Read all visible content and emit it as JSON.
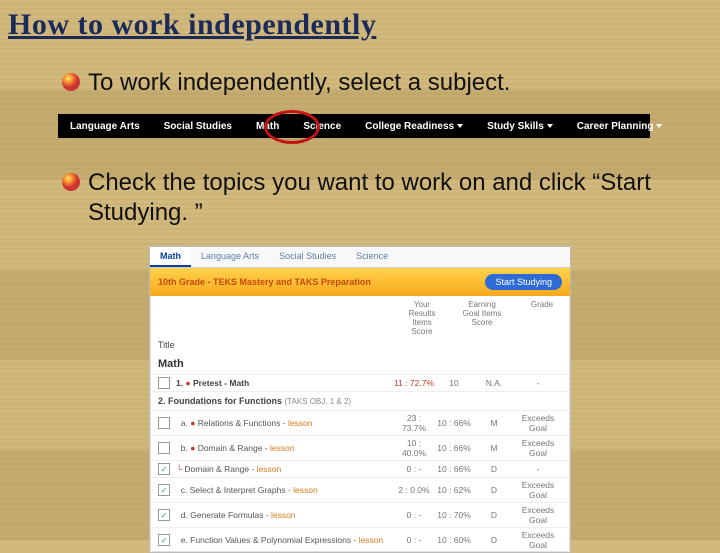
{
  "title": "How to work independently",
  "point1": "To work independently, select a subject.",
  "point2": "Check the topics you want to work on and click “Start Studying. ”",
  "navbar": {
    "items": [
      "Language Arts",
      "Social Studies",
      "Math",
      "Science",
      "College Readiness",
      "Study Skills",
      "Career Planning"
    ]
  },
  "panel": {
    "tabs": [
      "Math",
      "Language Arts",
      "Social Studies",
      "Science"
    ],
    "band_title": "10th Grade - TEKS Mastery and TAKS Preparation",
    "band_button": "Start Studying",
    "thead": {
      "c1": "Your Results Items Score",
      "c2": "Earning Goal Items Score",
      "c3": "Grade"
    },
    "title_label": "Title",
    "subject": "Math",
    "row0": {
      "name": "1.",
      "bullet": "●",
      "label": "Pretest - Math",
      "c1": "11 : 72.7%",
      "c2": "10",
      "c3": "N.A.",
      "c4": "-"
    },
    "section2": {
      "title": "2. Foundations for Functions",
      "meta": "(TAKS OBJ. 1 & 2)"
    },
    "rows": [
      {
        "cb": false,
        "name": "a.",
        "bullet": "●",
        "label": "Relations & Functions",
        "tag": "lesson",
        "c1": "23 : 73.7%",
        "c2": "10 : 66%",
        "c3": "M",
        "c4": "Exceeds Goal"
      },
      {
        "cb": false,
        "name": "b.",
        "bullet": "●",
        "label": "Domain & Range",
        "tag": "lesson",
        "c1": "10 : 40.0%",
        "c2": "10 : 66%",
        "c3": "M",
        "c4": "Exceeds Goal"
      },
      {
        "cb": true,
        "name": "",
        "bullet": "└",
        "label": "Domain & Range",
        "tag": "lesson",
        "c1": "0 : -",
        "c2": "10 : 66%",
        "c3": "D",
        "c4": "-"
      },
      {
        "cb": true,
        "name": "c.",
        "bullet": "",
        "label": "Select & Interpret Graphs",
        "tag": "lesson",
        "c1": "2 : 0.0%",
        "c2": "10 : 62%",
        "c3": "D",
        "c4": "Exceeds Goal"
      },
      {
        "cb": true,
        "name": "d.",
        "bullet": "",
        "label": "Generate Formulas",
        "tag": "lesson",
        "c1": "0 : -",
        "c2": "10 : 70%",
        "c3": "D",
        "c4": "Exceeds Goal"
      },
      {
        "cb": true,
        "name": "e.",
        "bullet": "",
        "label": "Function Values & Polynomial Expressions",
        "tag": "lesson",
        "c1": "0 : -",
        "c2": "10 : 60%",
        "c3": "D",
        "c4": "Exceeds Goal"
      }
    ]
  }
}
